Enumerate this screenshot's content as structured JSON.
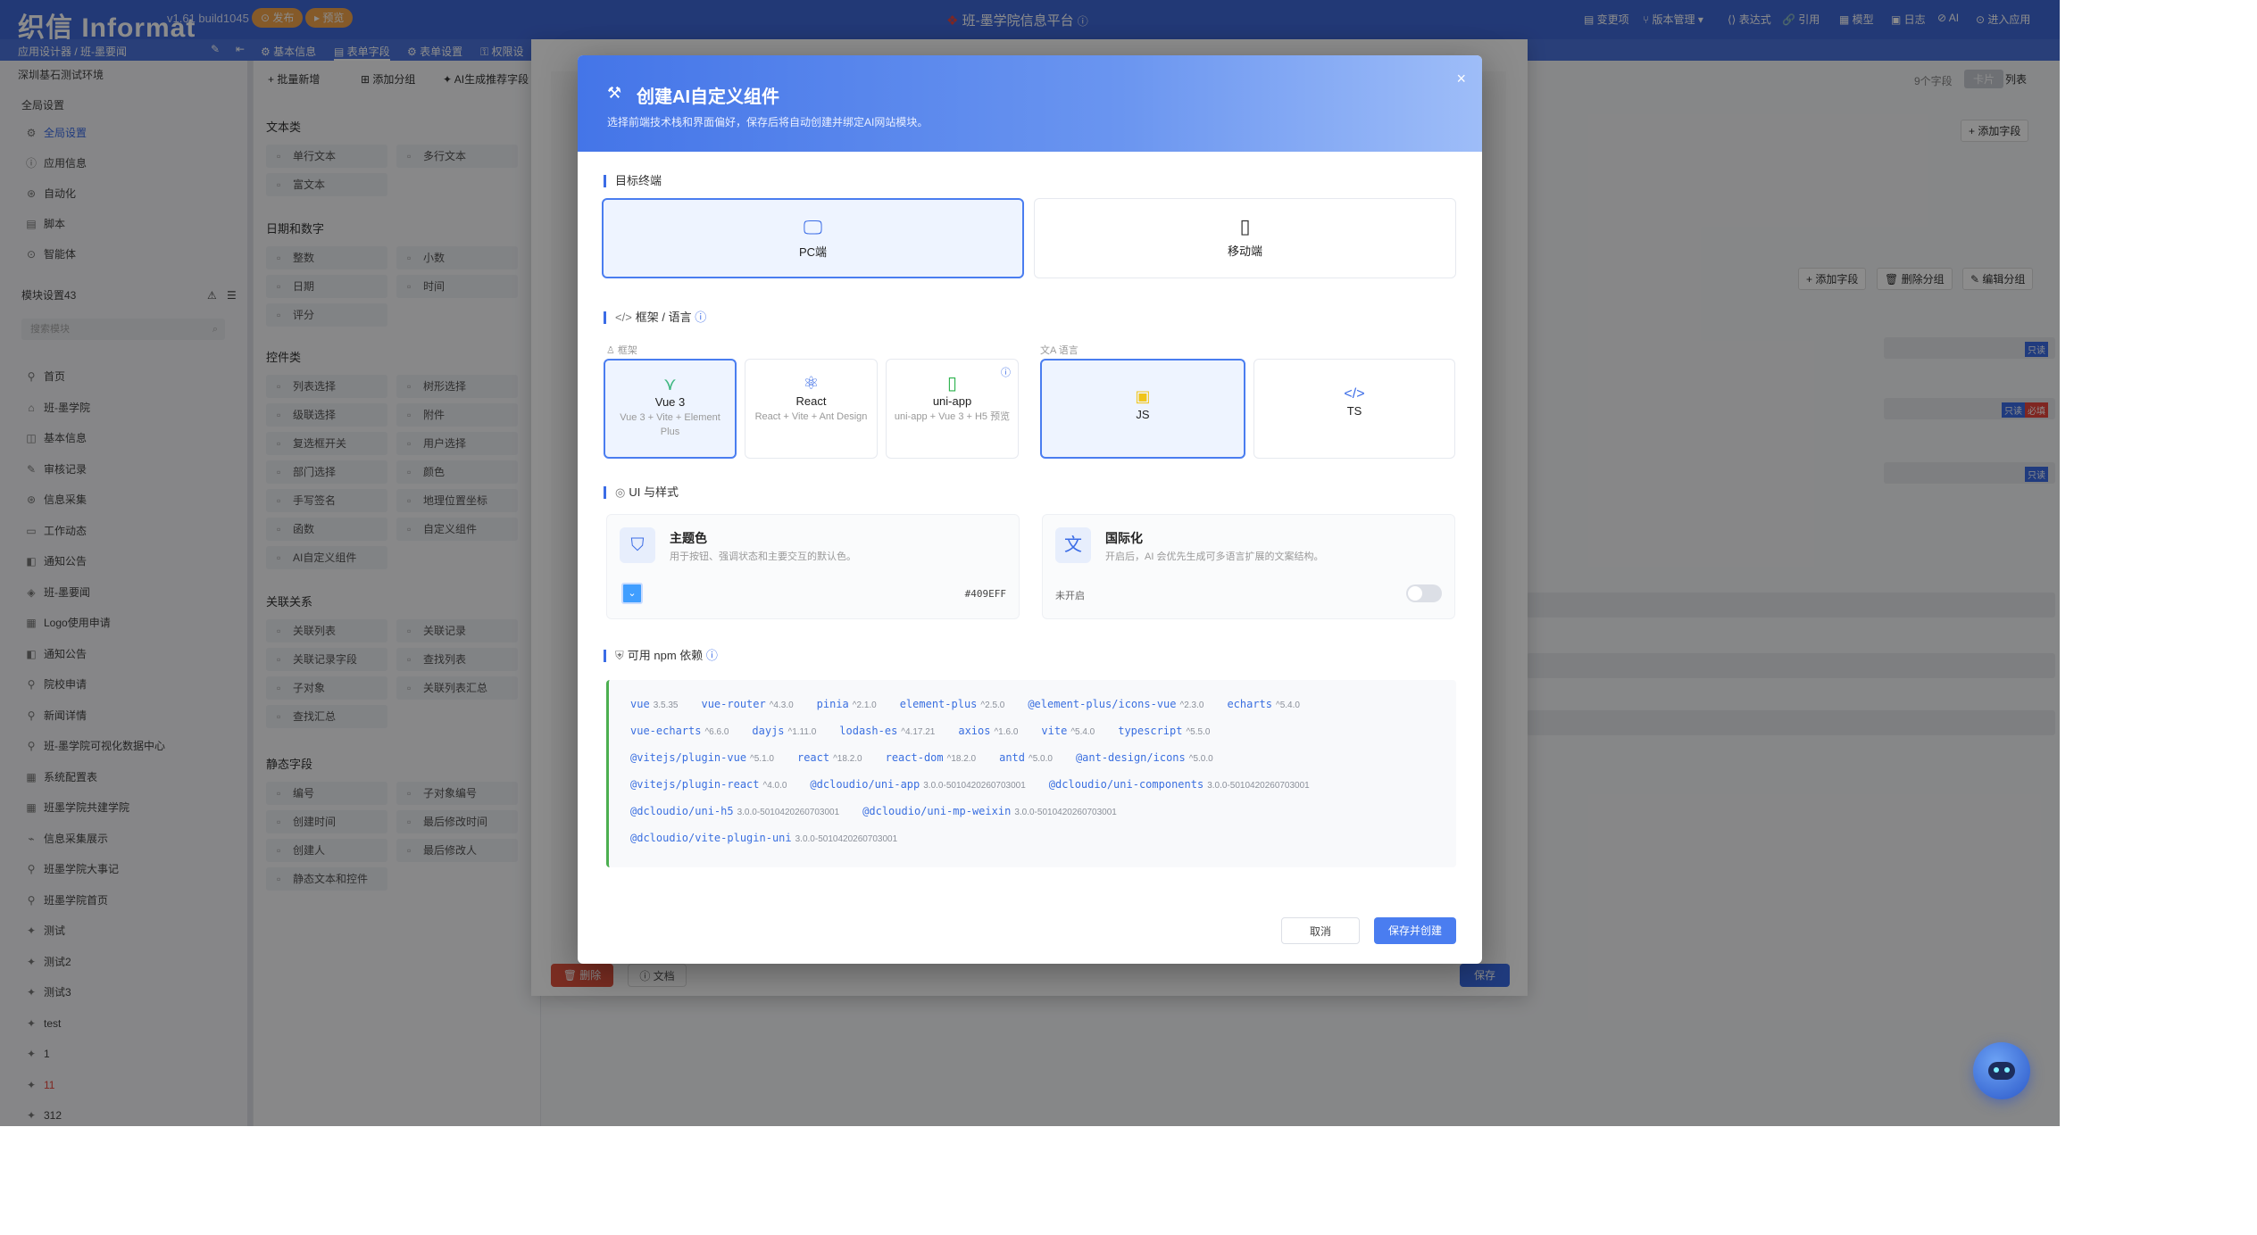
{
  "topbar": {
    "logo": "织信 Informat",
    "version": "v1.61 build1045",
    "publish": "发布",
    "preview": "预览",
    "app_title": "班-墨学院信息平台",
    "nav": [
      "变更项",
      "版本管理",
      "表达式",
      "引用",
      "模型",
      "日志",
      "AI",
      "进入应用"
    ]
  },
  "subbar": {
    "breadcrumb": "应用设计器 / 班-墨要闻",
    "tabs": [
      "基本信息",
      "表单字段",
      "表单设置",
      "权限设"
    ]
  },
  "sidebar": {
    "env": "深圳基石测试环境",
    "global_header": "全局设置",
    "global_items": [
      "全局设置",
      "应用信息",
      "自动化",
      "脚本",
      "智能体"
    ],
    "module_header": "模块设置43",
    "search_placeholder": "搜索模块",
    "modules": [
      "首页",
      "班-墨学院",
      "基本信息",
      "审核记录",
      "信息采集",
      "工作动态",
      "通知公告",
      "班-墨要闻",
      "Logo使用申请",
      "通知公告",
      "院校申请",
      "新闻详情",
      "班-墨学院可视化数据中心",
      "系统配置表",
      "班墨学院共建学院",
      "信息采集展示",
      "班墨学院大事记",
      "班墨学院首页",
      "测试",
      "测试2",
      "测试3",
      "test",
      "1",
      "11",
      "312"
    ]
  },
  "fieldpanel": {
    "batch_add": "批量新增",
    "add_group": "添加分组",
    "ai_fields": "AI生成推荐字段",
    "categories": [
      {
        "name": "文本类",
        "items": [
          "单行文本",
          "多行文本",
          "富文本"
        ]
      },
      {
        "name": "日期和数字",
        "items": [
          "整数",
          "小数",
          "日期",
          "时间",
          "评分"
        ]
      },
      {
        "name": "控件类",
        "items": [
          "列表选择",
          "树形选择",
          "级联选择",
          "附件",
          "复选框开关",
          "用户选择",
          "部门选择",
          "颜色",
          "手写签名",
          "地理位置坐标",
          "函数",
          "自定义组件",
          "AI自定义组件"
        ]
      },
      {
        "name": "关联关系",
        "items": [
          "关联列表",
          "关联记录",
          "关联记录字段",
          "查找列表",
          "子对象",
          "关联列表汇总",
          "查找汇总"
        ]
      },
      {
        "name": "静态字段",
        "items": [
          "编号",
          "子对象编号",
          "创建时间",
          "最后修改时间",
          "创建人",
          "最后修改人",
          "静态文本和控件"
        ]
      }
    ]
  },
  "right": {
    "field_count": "9个字段",
    "view_card": "卡片",
    "view_list": "列表",
    "add_field": "添加字段",
    "delete_group": "删除分组",
    "edit_group": "编辑分组",
    "readonly": "只读",
    "required": "必填"
  },
  "bgdialog": {
    "delete": "删除",
    "docs": "文档",
    "save": "保存"
  },
  "modal": {
    "title": "创建AI自定义组件",
    "subtitle": "选择前端技术栈和界面偏好，保存后将自动创建并绑定AI网站模块。",
    "target_label": "目标终端",
    "targets": [
      {
        "label": "PC端",
        "icon": "monitor-icon"
      },
      {
        "label": "移动端",
        "icon": "phone-icon"
      }
    ],
    "framework_section": "框架 / 语言",
    "framework_sub": "框架",
    "language_sub": "语言",
    "frameworks": [
      {
        "name": "Vue 3",
        "desc": "Vue 3 + Vite + Element Plus"
      },
      {
        "name": "React",
        "desc": "React + Vite + Ant Design"
      },
      {
        "name": "uni-app",
        "desc": "uni-app + Vue 3 + H5 预览"
      }
    ],
    "languages": [
      "JS",
      "TS"
    ],
    "ui_section": "UI 与样式",
    "theme": {
      "title": "主题色",
      "desc": "用于按钮、强调状态和主要交互的默认色。",
      "value": "#409EFF"
    },
    "i18n": {
      "title": "国际化",
      "desc": "开启后，AI 会优先生成可多语言扩展的文案结构。",
      "status": "未开启"
    },
    "npm_section": "可用 npm 依赖",
    "packages": [
      [
        {
          "n": "vue",
          "v": "3.5.35"
        },
        {
          "n": "vue-router",
          "v": "^4.3.0"
        },
        {
          "n": "pinia",
          "v": "^2.1.0"
        },
        {
          "n": "element-plus",
          "v": "^2.5.0"
        },
        {
          "n": "@element-plus/icons-vue",
          "v": "^2.3.0"
        },
        {
          "n": "echarts",
          "v": "^5.4.0"
        }
      ],
      [
        {
          "n": "vue-echarts",
          "v": "^6.6.0"
        },
        {
          "n": "dayjs",
          "v": "^1.11.0"
        },
        {
          "n": "lodash-es",
          "v": "^4.17.21"
        },
        {
          "n": "axios",
          "v": "^1.6.0"
        },
        {
          "n": "vite",
          "v": "^5.4.0"
        },
        {
          "n": "typescript",
          "v": "^5.5.0"
        }
      ],
      [
        {
          "n": "@vitejs/plugin-vue",
          "v": "^5.1.0"
        },
        {
          "n": "react",
          "v": "^18.2.0"
        },
        {
          "n": "react-dom",
          "v": "^18.2.0"
        },
        {
          "n": "antd",
          "v": "^5.0.0"
        },
        {
          "n": "@ant-design/icons",
          "v": "^5.0.0"
        }
      ],
      [
        {
          "n": "@vitejs/plugin-react",
          "v": "^4.0.0"
        },
        {
          "n": "@dcloudio/uni-app",
          "v": "3.0.0-5010420260703001"
        },
        {
          "n": "@dcloudio/uni-components",
          "v": "3.0.0-5010420260703001"
        }
      ],
      [
        {
          "n": "@dcloudio/uni-h5",
          "v": "3.0.0-5010420260703001"
        },
        {
          "n": "@dcloudio/uni-mp-weixin",
          "v": "3.0.0-5010420260703001"
        }
      ],
      [
        {
          "n": "@dcloudio/vite-plugin-uni",
          "v": "3.0.0-5010420260703001"
        }
      ]
    ],
    "cancel": "取消",
    "save_create": "保存并创建",
    "colors": {
      "primary": "#409EFF",
      "selected_border": "#4a7df0"
    }
  }
}
